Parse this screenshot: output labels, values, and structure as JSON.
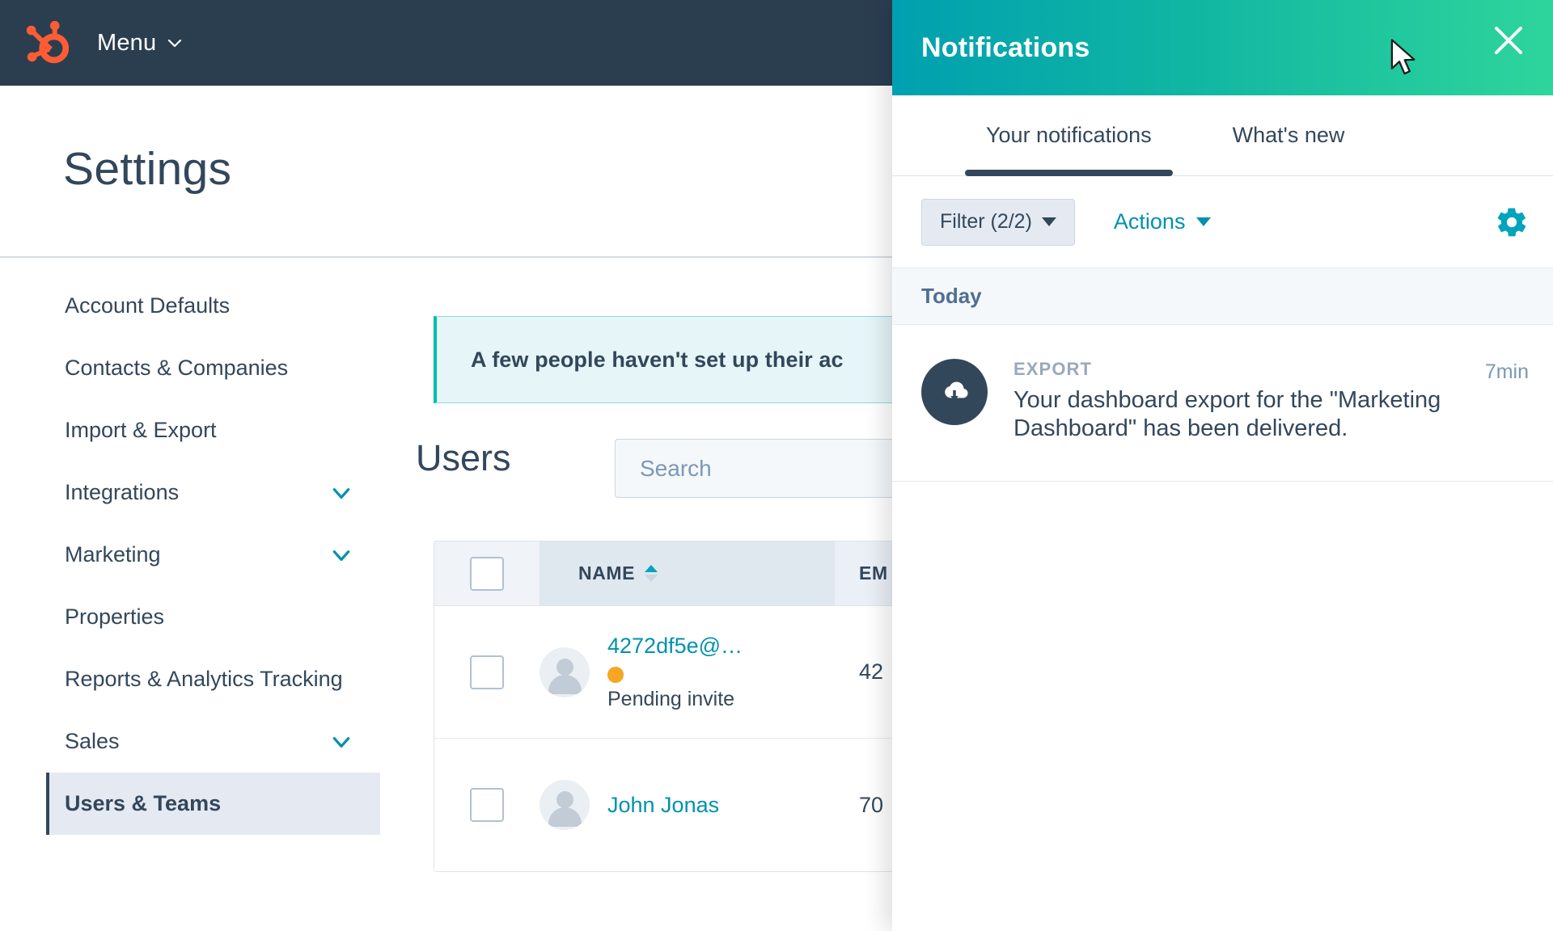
{
  "topbar": {
    "logo_icon": "hubspot-sprocket-logo",
    "menu_label": "Menu",
    "menu_caret_icon": "chevron-down-icon"
  },
  "page": {
    "title": "Settings"
  },
  "sidebar": {
    "items": [
      {
        "label": "Account Defaults",
        "expandable": false,
        "active": false
      },
      {
        "label": "Contacts & Companies",
        "expandable": false,
        "active": false
      },
      {
        "label": "Import & Export",
        "expandable": false,
        "active": false
      },
      {
        "label": "Integrations",
        "expandable": true,
        "active": false
      },
      {
        "label": "Marketing",
        "expandable": true,
        "active": false
      },
      {
        "label": "Properties",
        "expandable": false,
        "active": false
      },
      {
        "label": "Reports & Analytics Tracking",
        "expandable": false,
        "active": false
      },
      {
        "label": "Sales",
        "expandable": true,
        "active": false
      },
      {
        "label": "Users & Teams",
        "expandable": false,
        "active": true
      }
    ],
    "expand_icon": "chevron-down-icon"
  },
  "main": {
    "banner": {
      "text": "A few people haven't set up their ac",
      "accent_color": "#00bda5",
      "background_color": "#e5f5f8"
    },
    "users_section": {
      "title": "Users",
      "search": {
        "placeholder": "Search",
        "value": ""
      },
      "table": {
        "columns": [
          {
            "key": "check",
            "label": "",
            "icon": "checkbox-icon"
          },
          {
            "key": "name",
            "label": "NAME",
            "sorted": "asc",
            "sort_icon": "sort-arrows-icon"
          },
          {
            "key": "email",
            "label": "EM"
          }
        ],
        "rows": [
          {
            "checked": false,
            "avatar_icon": "user-avatar-icon",
            "name": "4272df5e@…",
            "status_dot_color": "#f5a623",
            "status": "Pending invite",
            "email": "42"
          },
          {
            "checked": false,
            "avatar_icon": "user-avatar-icon",
            "name": "John Jonas",
            "status_dot_color": "",
            "status": "",
            "email": "70"
          }
        ]
      }
    }
  },
  "notifications_panel": {
    "title": "Notifications",
    "close_icon": "close-icon",
    "header_gradient_start": "#00a0b0",
    "header_gradient_end": "#2ed59b",
    "tabs": [
      {
        "label": "Your notifications",
        "active": true
      },
      {
        "label": "What's new",
        "active": false
      }
    ],
    "toolbar": {
      "filter_label": "Filter (2/2)",
      "filter_caret_icon": "caret-down-icon",
      "actions_label": "Actions",
      "actions_caret_icon": "caret-down-icon",
      "settings_icon": "gear-icon"
    },
    "groups": [
      {
        "label": "Today",
        "items": [
          {
            "icon": "cloud-download-icon",
            "kicker": "EXPORT",
            "message": "Your dashboard export for the \"Marketing Dashboard\" has been delivered.",
            "time": "7min"
          }
        ]
      }
    ]
  },
  "cursor": {
    "icon": "mouse-pointer-icon"
  }
}
